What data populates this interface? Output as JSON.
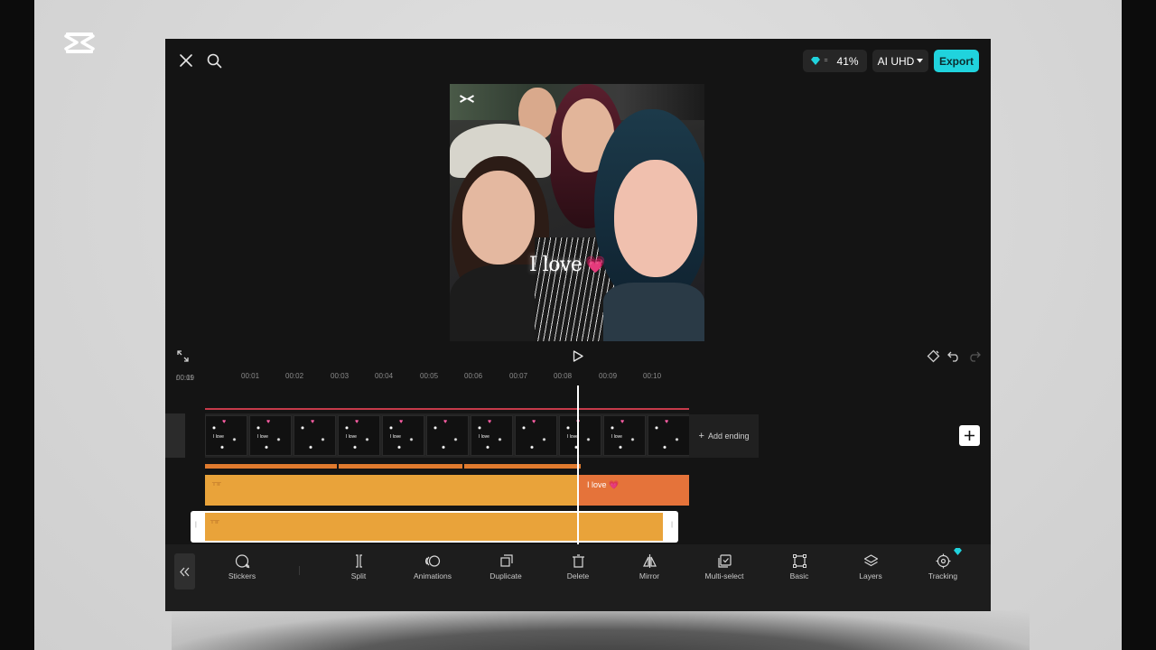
{
  "app": {
    "logo_icon": "capcut-logo-icon",
    "topbar": {
      "close_icon": "close-icon",
      "search_icon": "search-icon",
      "credits_icon": "diamond-icon",
      "credits_value": "41%",
      "quality_label": "AI UHD",
      "export_label": "Export",
      "accent": "#20d3dd"
    },
    "preview": {
      "overlay_text": "I love",
      "overlay_emoji": "💗"
    },
    "controls": {
      "fullscreen_icon": "fullscreen-icon",
      "play_icon": "play-icon",
      "keyframe_icon": "keyframe-icon",
      "undo_icon": "undo-icon",
      "redo_icon": "redo-icon"
    },
    "timeline": {
      "current_time": "00:09",
      "total_time": "00:11",
      "ruler_ticks": [
        "00:01",
        "00:02",
        "00:03",
        "00:04",
        "00:05",
        "00:06",
        "00:07",
        "00:08",
        "00:09",
        "00:10"
      ],
      "add_ending_label": "Add ending",
      "text_clip_label": "I love 💗",
      "clip_colors": {
        "text_clip": "#e9a33a",
        "selected_clip": "#e5733a",
        "strip": "#e07a2e"
      }
    },
    "toolbar": {
      "items": [
        {
          "label": "Stickers",
          "icon": "sticker-icon"
        },
        {
          "label": "Split",
          "icon": "split-icon"
        },
        {
          "label": "Animations",
          "icon": "animations-icon"
        },
        {
          "label": "Duplicate",
          "icon": "duplicate-icon"
        },
        {
          "label": "Delete",
          "icon": "delete-icon"
        },
        {
          "label": "Mirror",
          "icon": "mirror-icon"
        },
        {
          "label": "Multi-select",
          "icon": "multi-select-icon"
        },
        {
          "label": "Basic",
          "icon": "basic-icon"
        },
        {
          "label": "Layers",
          "icon": "layers-icon"
        },
        {
          "label": "Tracking",
          "icon": "tracking-icon"
        }
      ]
    }
  }
}
